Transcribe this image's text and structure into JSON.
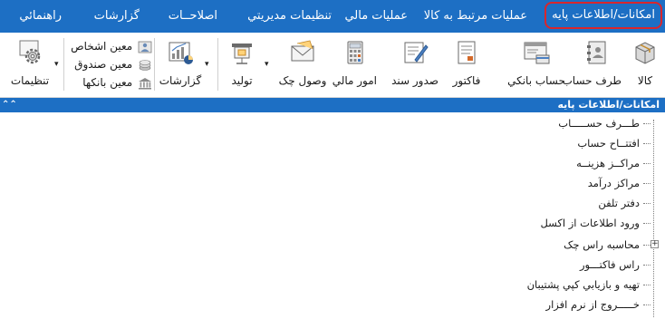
{
  "menu": {
    "items": [
      {
        "label": "امکانات/اطلاعات پايه"
      },
      {
        "label": "عمليات مرتبط به کالا"
      },
      {
        "label": "عمليات مالي"
      },
      {
        "label": "تنظيمات مديريتي"
      },
      {
        "label": "اصلاحــات"
      },
      {
        "label": "گزارشات"
      },
      {
        "label": "راهنمائي"
      }
    ]
  },
  "toolbar": {
    "buttons": {
      "kala": "کالا",
      "taraf_hesab": "طرف حساب",
      "hesab_banki": "حساب بانکي",
      "factor": "فاکتور",
      "sodoor_sanad": "صدور سند",
      "omor_mali": "امور مالي",
      "vosool_check": "وصول چک",
      "tolid": "توليد",
      "gozareshat": "گزارشات",
      "tanzimat": "تنظيمات"
    },
    "small": {
      "moein_ashkhas": "معين اشخاص",
      "moein_sandogh": "معين صندوق",
      "moein_bankha": "معين بانکها"
    },
    "dropdown_glyph": "▾"
  },
  "panel": {
    "title": "امکانات/اطلاعات پايه",
    "collapse_glyph": "⌃⌃"
  },
  "tree": {
    "items": [
      {
        "label": "طـــرف حســـــاب"
      },
      {
        "label": "افتتــاح حساب"
      },
      {
        "label": "مراکــز هزينــه"
      },
      {
        "label": "مراکز درآمد"
      },
      {
        "label": "دفتر تلفن"
      },
      {
        "label": "ورود اطلاعات از اکسل"
      },
      {
        "label": "محاسبه راس چک",
        "expander": "+"
      },
      {
        "label": "راس فاکتـــور"
      },
      {
        "label": "تهيه و بازيابي کپي پشتيبان"
      },
      {
        "label": "خـــــروج از نرم افزار"
      }
    ]
  },
  "colors": {
    "menu_bg": "#1d6fc4",
    "active_outline": "#d9262c",
    "text": "#1a1a1a"
  }
}
